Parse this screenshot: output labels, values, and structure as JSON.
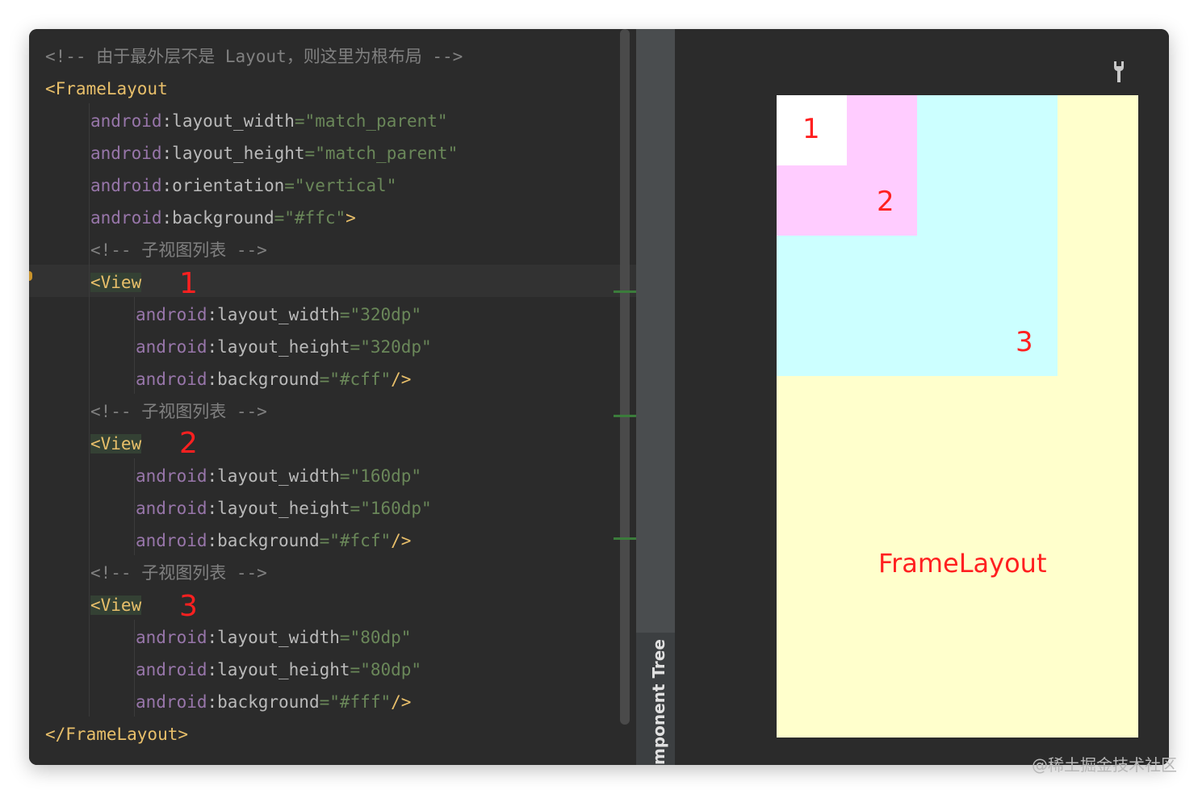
{
  "code": {
    "comment_root": "<!-- 由于最外层不是 Layout，则这里为根布局 -->",
    "frame_open": "<FrameLayout",
    "ns": "android",
    "frame_attrs": [
      {
        "name": "layout_width",
        "value": "\"match_parent\""
      },
      {
        "name": "layout_height",
        "value": "\"match_parent\""
      },
      {
        "name": "orientation",
        "value": "\"vertical\""
      },
      {
        "name": "background",
        "value": "\"#ffc\""
      }
    ],
    "child_comment": "<!-- 子视图列表 -->",
    "view_tag": "<View",
    "views": [
      {
        "label": "1",
        "width": "\"320dp\"",
        "height": "\"320dp\"",
        "background": "\"#cff\""
      },
      {
        "label": "2",
        "width": "\"160dp\"",
        "height": "\"160dp\"",
        "background": "\"#fcf\""
      },
      {
        "label": "3",
        "width": "\"80dp\"",
        "height": "\"80dp\"",
        "background": "\"#fff\""
      }
    ],
    "frame_close": "</FrameLayout>"
  },
  "side_panel": {
    "label": "mponent Tree"
  },
  "preview": {
    "labels": {
      "v1": "1",
      "v2": "2",
      "v3": "3",
      "frame": "FrameLayout"
    },
    "colors": {
      "frame": "#ffffcc",
      "view1": "#ccffff",
      "view2": "#ffccff",
      "view3": "#ffffff",
      "label": "#ff2020"
    },
    "icon": "wrench-icon"
  },
  "watermark": "@稀土掘金技术社区"
}
